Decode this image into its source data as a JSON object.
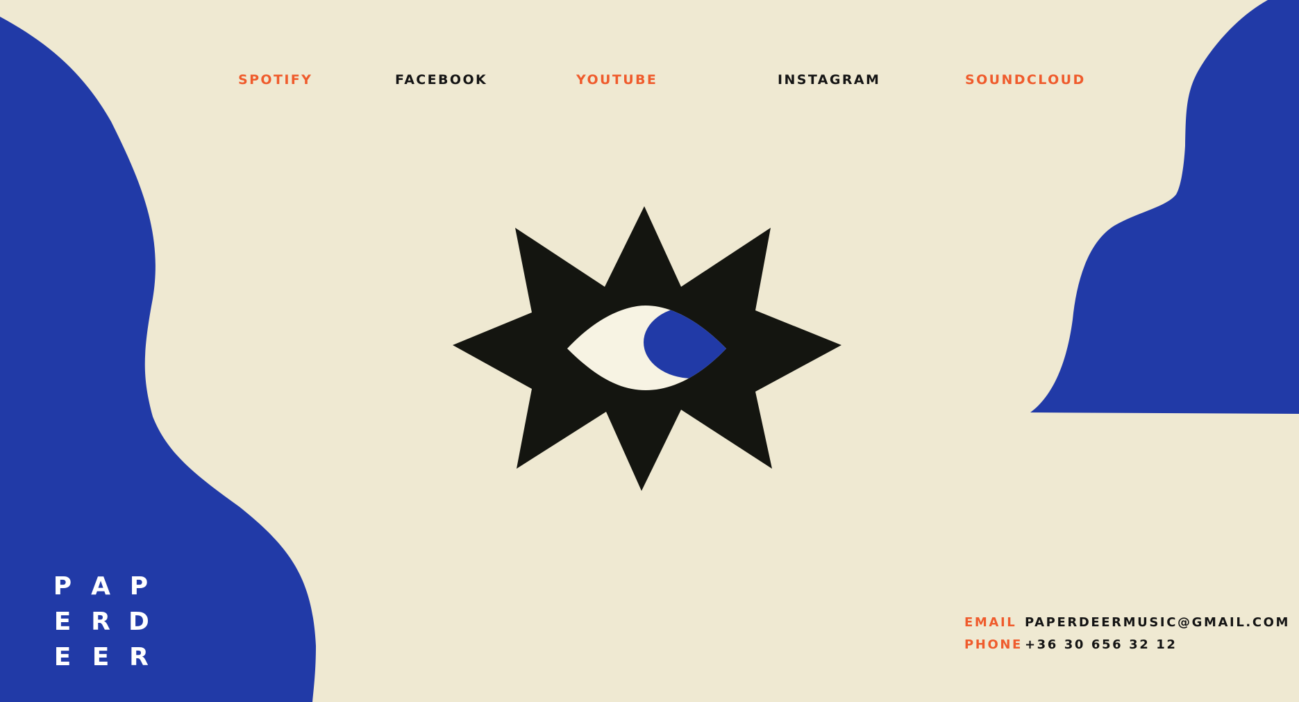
{
  "colors": {
    "background": "#efe9d2",
    "blue": "#213aa7",
    "accent": "#ef5b2c",
    "ink": "#141510",
    "white": "#ffffff"
  },
  "nav": [
    {
      "label": "SPOTIFY",
      "color": "#ef5b2c"
    },
    {
      "label": "FACEBOOK",
      "color": "#141414"
    },
    {
      "label": "YOUTUBE",
      "color": "#ef5b2c"
    },
    {
      "label": "INSTAGRAM",
      "color": "#141414"
    },
    {
      "label": "SOUNDCLOUD",
      "color": "#ef5b2c"
    }
  ],
  "emblem": {
    "icon": "star-eye-icon"
  },
  "logo": {
    "letters": [
      "P",
      "A",
      "P",
      "E",
      "R",
      "D",
      "E",
      "E",
      "R"
    ]
  },
  "contact": {
    "email_label": "EMAIL",
    "email_value": "PAPERDEERMUSIC@GMAIL.COM",
    "phone_label": "PHONE",
    "phone_value": "+36 30 656 32 12"
  }
}
